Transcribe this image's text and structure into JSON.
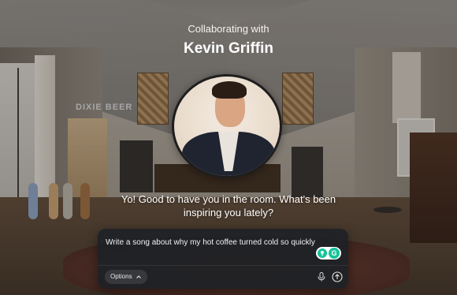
{
  "header": {
    "subtitle": "Collaborating with",
    "title": "Kevin Griffin"
  },
  "background": {
    "neon_sign": "DIXIE BEER"
  },
  "assistant_message": "Yo! Good to have you in the room. What's been inspiring you lately?",
  "composer": {
    "input_value": "Write a song about why my hot coffee turned cold so quickly",
    "options_label": "Options",
    "icons": {
      "grammar": "grammarly-icon",
      "mic": "microphone-icon",
      "send": "send-arrow-icon",
      "chevron": "chevron-up-icon"
    }
  },
  "colors": {
    "composer_bg": "#1e2126",
    "grammar_green": "#15c39a",
    "text": "#ffffff"
  }
}
